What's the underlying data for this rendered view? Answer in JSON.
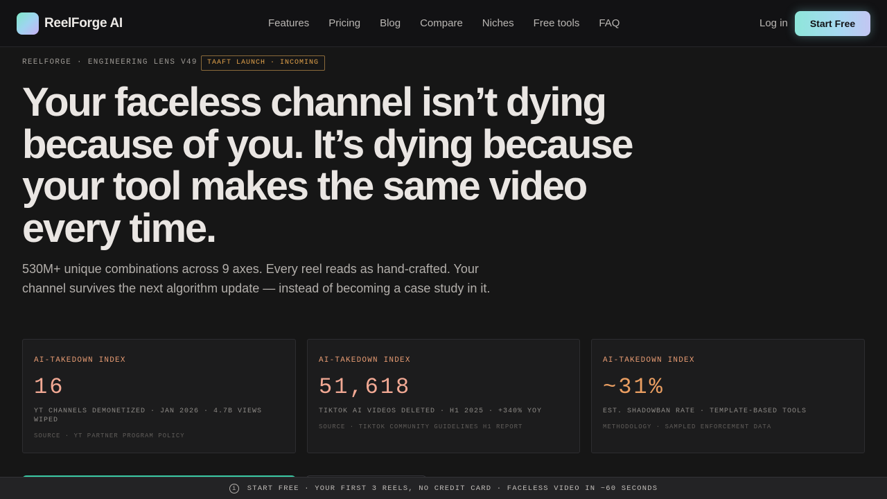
{
  "brand": {
    "name": "ReelForge AI",
    "logo_icon": "gradient-square-logo"
  },
  "nav": {
    "items": [
      {
        "label": "Features"
      },
      {
        "label": "Pricing"
      },
      {
        "label": "Blog"
      },
      {
        "label": "Compare"
      },
      {
        "label": "Niches"
      },
      {
        "label": "Free tools"
      },
      {
        "label": "FAQ"
      }
    ],
    "login_label": "Log in",
    "start_label": "Start Free"
  },
  "hero": {
    "eyebrow": "REELFORGE · ENGINEERING LENS V49",
    "tag": "TAAFT LAUNCH · INCOMING",
    "headline": "Your faceless channel isn’t dying because of you. It’s dying because your tool makes the same video every time.",
    "subtext": "530M+ unique combinations across 9 axes. Every reel reads as hand-crafted. Your channel survives the next algorithm update — instead of becoming a case study in it."
  },
  "stats": [
    {
      "label": "AI-TAKEDOWN INDEX",
      "value": "16",
      "description": "YT CHANNELS DEMONETIZED · JAN 2026 · 4.7B VIEWS WIPED",
      "source": "SOURCE · YT PARTNER PROGRAM POLICY"
    },
    {
      "label": "AI-TAKEDOWN INDEX",
      "value": "51,618",
      "description": "TIKTOK AI VIDEOS DELETED · H1 2025 · +340% YOY",
      "source": "SOURCE · TIKTOK COMMUNITY GUIDELINES H1 REPORT"
    },
    {
      "label": "AI-TAKEDOWN INDEX",
      "value": "~31%",
      "description": "EST. SHADOWBAN RATE · TEMPLATE-BASED TOOLS",
      "source": "METHODOLOGY · SAMPLED ENFORCEMENT DATA"
    }
  ],
  "banner": {
    "icon": "info-icon",
    "text": "START FREE · YOUR FIRST 3 REELS, NO CREDIT CARD · FACELESS VIDEO IN ~60 SECONDS"
  },
  "colors": {
    "accent_gradient_start": "#8ee6da",
    "accent_gradient_end": "#c3c6f2",
    "stat_label": "#e59a72",
    "stat_value": "#f2a994",
    "stat_value_alt": "#eb9f62",
    "tag": "#e0a04a"
  }
}
